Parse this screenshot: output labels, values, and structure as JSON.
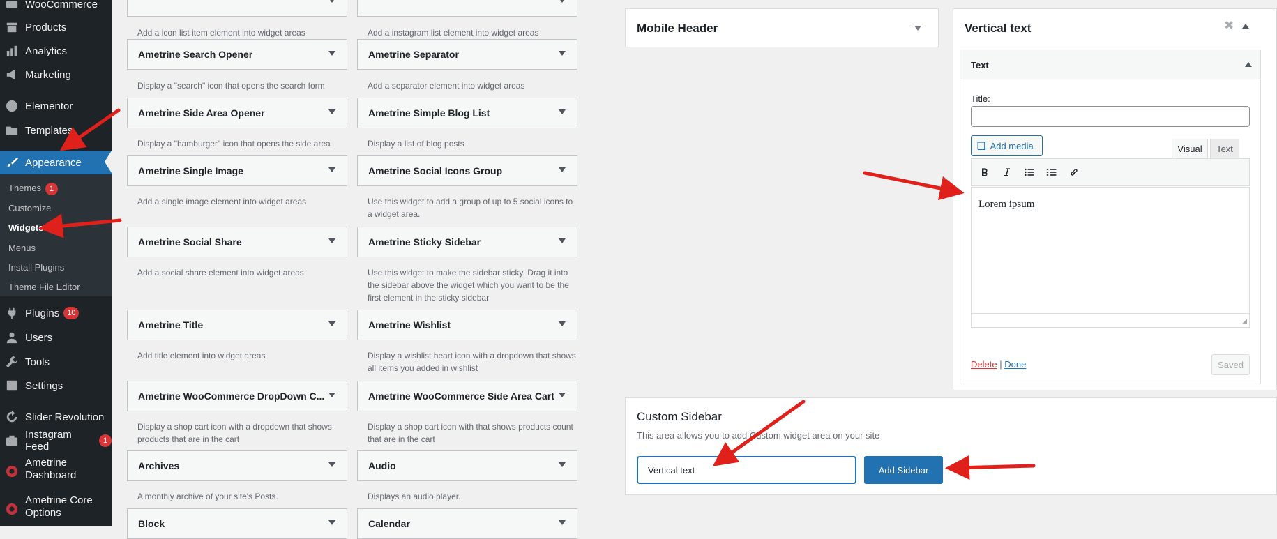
{
  "sidebar": {
    "menu": [
      {
        "label": "WooCommerce",
        "icon": "woo-icon"
      },
      {
        "label": "Products",
        "icon": "archive-icon"
      },
      {
        "label": "Analytics",
        "icon": "chart-bar-icon"
      },
      {
        "label": "Marketing",
        "icon": "megaphone-icon"
      },
      {
        "label": "Elementor",
        "icon": "elementor-icon"
      },
      {
        "label": "Templates",
        "icon": "folder-icon"
      },
      {
        "label": "Appearance",
        "icon": "paintbrush-icon"
      },
      {
        "label": "Plugins",
        "icon": "plugin-icon",
        "badge": "10"
      },
      {
        "label": "Users",
        "icon": "user-icon"
      },
      {
        "label": "Tools",
        "icon": "wrench-icon"
      },
      {
        "label": "Settings",
        "icon": "sliders-icon"
      },
      {
        "label": "Slider Revolution",
        "icon": "refresh-icon"
      },
      {
        "label": "Instagram Feed",
        "icon": "camera-icon",
        "badge": "1"
      },
      {
        "label": "Ametrine Dashboard",
        "icon": "ametrine-icon"
      },
      {
        "label": "Ametrine Core Options",
        "icon": "ametrine-icon"
      }
    ],
    "submenu": [
      {
        "label": "Themes",
        "badge": "1"
      },
      {
        "label": "Customize"
      },
      {
        "label": "Widgets"
      },
      {
        "label": "Menus"
      },
      {
        "label": "Install Plugins"
      },
      {
        "label": "Theme File Editor"
      }
    ]
  },
  "widgets": {
    "col1": [
      {
        "title": "",
        "desc": "Add a icon list item element into widget areas"
      },
      {
        "title": "Ametrine Search Opener",
        "desc": "Display a \"search\" icon that opens the search form"
      },
      {
        "title": "Ametrine Side Area Opener",
        "desc": "Display a \"hamburger\" icon that opens the side area"
      },
      {
        "title": "Ametrine Single Image",
        "desc": "Add a single image element into widget areas"
      },
      {
        "title": "Ametrine Social Share",
        "desc": "Add a social share element into widget areas"
      },
      {
        "title": "Ametrine Title",
        "desc": "Add title element into widget areas"
      },
      {
        "title": "Ametrine WooCommerce DropDown C...",
        "desc": "Display a shop cart icon with a dropdown that shows products that are in the cart"
      },
      {
        "title": "Archives",
        "desc": "A monthly archive of your site's Posts."
      },
      {
        "title": "Block",
        "desc": ""
      }
    ],
    "col2": [
      {
        "title": "",
        "desc": "Add a instagram list element into widget areas"
      },
      {
        "title": "Ametrine Separator",
        "desc": "Add a separator element into widget areas"
      },
      {
        "title": "Ametrine Simple Blog List",
        "desc": "Display a list of blog posts"
      },
      {
        "title": "Ametrine Social Icons Group",
        "desc": "Use this widget to add a group of up to 5 social icons to a widget area."
      },
      {
        "title": "Ametrine Sticky Sidebar",
        "desc": "Use this widget to make the sidebar sticky. Drag it into the sidebar above the widget which you want to be the first element in the sticky sidebar"
      },
      {
        "title": "Ametrine Wishlist",
        "desc": "Display a wishlist heart icon with a dropdown that shows all items you added in wishlist"
      },
      {
        "title": "Ametrine WooCommerce Side Area Cart",
        "desc": "Display a shop cart icon with that shows products count that are in the cart"
      },
      {
        "title": "Audio",
        "desc": "Displays an audio player."
      },
      {
        "title": "Calendar",
        "desc": ""
      }
    ]
  },
  "mobile_header": {
    "title": "Mobile Header"
  },
  "vertical_text": {
    "title": "Vertical text",
    "inner_title": "Text",
    "title_label": "Title:",
    "title_value": "",
    "add_media": "Add media",
    "tab_visual": "Visual",
    "tab_text": "Text",
    "content": "Lorem ipsum",
    "delete": "Delete",
    "separator": "|",
    "done": "Done",
    "saved": "Saved"
  },
  "custom_sidebar": {
    "title": "Custom Sidebar",
    "desc": "This area allows you to add Custom widget area on your site",
    "input_value": "Vertical text",
    "button": "Add Sidebar"
  },
  "colors": {
    "accent": "#2271b1",
    "sidebar": "#1d2327",
    "arrow": "#e0201b",
    "badge": "#d63638"
  }
}
